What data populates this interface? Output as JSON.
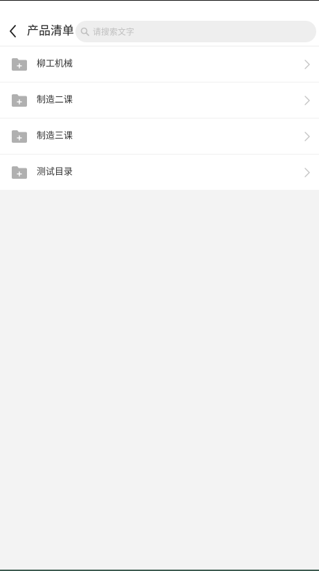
{
  "header": {
    "back_icon": "chevron-left-icon",
    "title": "产品清单",
    "search": {
      "icon": "search-icon",
      "placeholder": "请搜索文字",
      "value": ""
    }
  },
  "list": {
    "items": [
      {
        "label": "柳工机械",
        "icon": "folder-plus-icon",
        "trailing_icon": "chevron-right-icon"
      },
      {
        "label": "制造二课",
        "icon": "folder-plus-icon",
        "trailing_icon": "chevron-right-icon"
      },
      {
        "label": "制造三课",
        "icon": "folder-plus-icon",
        "trailing_icon": "chevron-right-icon"
      },
      {
        "label": "测试目录",
        "icon": "folder-plus-icon",
        "trailing_icon": "chevron-right-icon"
      }
    ]
  },
  "colors": {
    "background": "#f3f3f3",
    "surface": "#ffffff",
    "folder_icon": "#b0b0b0",
    "chevron": "#c4c4c4",
    "placeholder": "#c0c0c0",
    "text": "#333333"
  }
}
